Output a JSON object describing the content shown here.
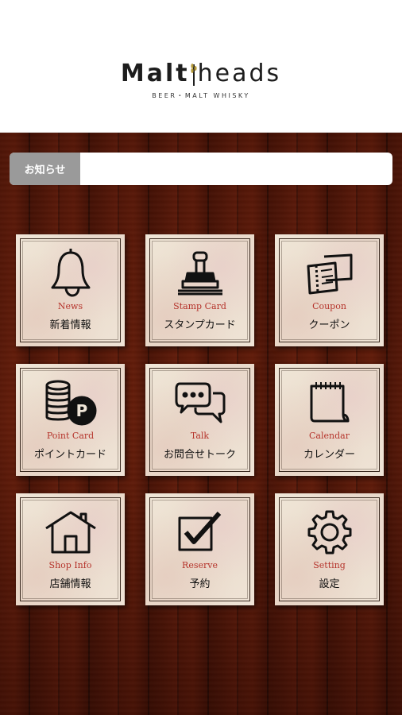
{
  "header": {
    "logo_text_a": "Malt",
    "logo_text_b": "heads",
    "logo_subtitle": "BEER・MALT WHISKY"
  },
  "notice": {
    "label": "お知らせ",
    "text": ""
  },
  "menu": [
    {
      "en": "News",
      "ja": "新着情報",
      "icon": "bell-icon"
    },
    {
      "en": "Stamp Card",
      "ja": "スタンプカード",
      "icon": "stamp-icon"
    },
    {
      "en": "Coupon",
      "ja": "クーポン",
      "icon": "coupon-icon"
    },
    {
      "en": "Point Card",
      "ja": "ポイントカード",
      "icon": "coins-icon"
    },
    {
      "en": "Talk",
      "ja": "お問合せトーク",
      "icon": "chat-bubbles-icon"
    },
    {
      "en": "Calendar",
      "ja": "カレンダー",
      "icon": "calendar-icon"
    },
    {
      "en": "Shop Info",
      "ja": "店舗情報",
      "icon": "house-icon"
    },
    {
      "en": "Reserve",
      "ja": "予約",
      "icon": "checkbox-icon"
    },
    {
      "en": "Setting",
      "ja": "設定",
      "icon": "gear-icon"
    }
  ],
  "colors": {
    "accent_red": "#b5332b",
    "notice_label_bg": "#9a9a9a",
    "wood": "#6b3922"
  }
}
